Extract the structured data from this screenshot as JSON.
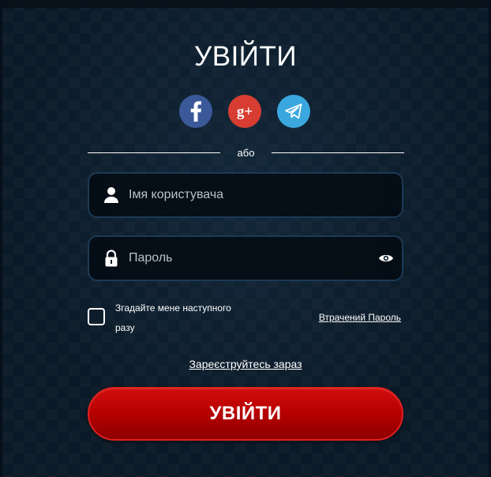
{
  "login": {
    "title": "УВІЙТИ",
    "divider_text": "або",
    "social": [
      {
        "icon": "facebook-icon",
        "color": "#3b5998"
      },
      {
        "icon": "google-plus-icon",
        "color": "#d73d32",
        "glyph": "g+"
      },
      {
        "icon": "telegram-icon",
        "color": "#3aa8de"
      }
    ],
    "username": {
      "placeholder": "Імя користувача",
      "value": ""
    },
    "password": {
      "placeholder": "Пароль",
      "value": ""
    },
    "remember_me": {
      "label": "Згадайте мене наступного разу",
      "checked": false
    },
    "lost_password": "Втрачений Пароль",
    "register": "Зареєструйтесь зараз",
    "submit": "УВІЙТИ",
    "accent_color": "#c00000"
  }
}
